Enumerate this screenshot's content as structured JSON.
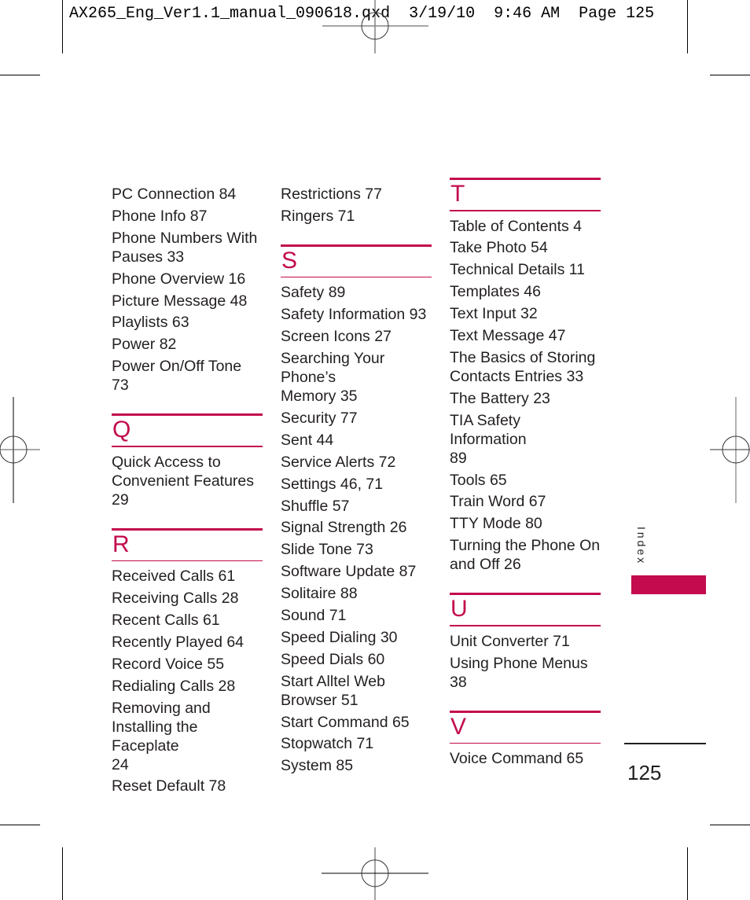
{
  "slug_line": "AX265_Eng_Ver1.1_manual_090618.qxd  3/19/10  9:46 AM  Page 125",
  "accent_color": "#c30b4e",
  "columns": [
    {
      "leading_entries": [
        "PC Connection 84",
        "Phone Info 87",
        "Phone Numbers With\nPauses 33",
        "Phone Overview 16",
        "Picture Message 48",
        "Playlists 63",
        "Power 82",
        "Power On/Off Tone 73"
      ],
      "sections": [
        {
          "letter": "Q",
          "entries": [
            "Quick Access to\nConvenient Features\n29"
          ]
        },
        {
          "letter": "R",
          "entries": [
            "Received Calls 61",
            "Receiving Calls 28",
            "Recent Calls 61",
            "Recently Played 64",
            "Record Voice 55",
            "Redialing Calls 28",
            "Removing and\nInstalling the Faceplate\n24",
            "Reset Default 78"
          ]
        }
      ]
    },
    {
      "leading_entries": [
        "Restrictions 77",
        "Ringers 71"
      ],
      "sections": [
        {
          "letter": "S",
          "entries": [
            "Safety 89",
            "Safety Information 93",
            "Screen Icons 27",
            "Searching Your Phone’s\nMemory 35",
            "Security 77",
            "Sent 44",
            "Service Alerts 72",
            "Settings 46, 71",
            "Shuffle 57",
            "Signal Strength 26",
            "Slide Tone 73",
            "Software Update 87",
            "Solitaire 88",
            "Sound 71",
            "Speed Dialing 30",
            "Speed Dials 60",
            "Start Alltel Web\nBrowser 51",
            "Start Command 65",
            "Stopwatch 71",
            "System 85"
          ]
        }
      ]
    },
    {
      "leading_entries": [],
      "sections": [
        {
          "letter": "T",
          "entries": [
            "Table of Contents 4",
            "Take Photo 54",
            "Technical Details 11",
            "Templates 46",
            "Text Input 32",
            "Text Message 47",
            "The Basics of Storing\nContacts Entries 33",
            "The Battery 23",
            "TIA Safety Information\n89",
            "Tools 65",
            "Train Word 67",
            "TTY Mode 80",
            "Turning the Phone On\nand Off 26"
          ]
        },
        {
          "letter": "U",
          "entries": [
            "Unit Converter 71",
            "Using Phone Menus\n38"
          ]
        },
        {
          "letter": "V",
          "entries": [
            "Voice Command 65"
          ]
        }
      ]
    }
  ],
  "side_tab_label": "Index",
  "page_number": "125"
}
